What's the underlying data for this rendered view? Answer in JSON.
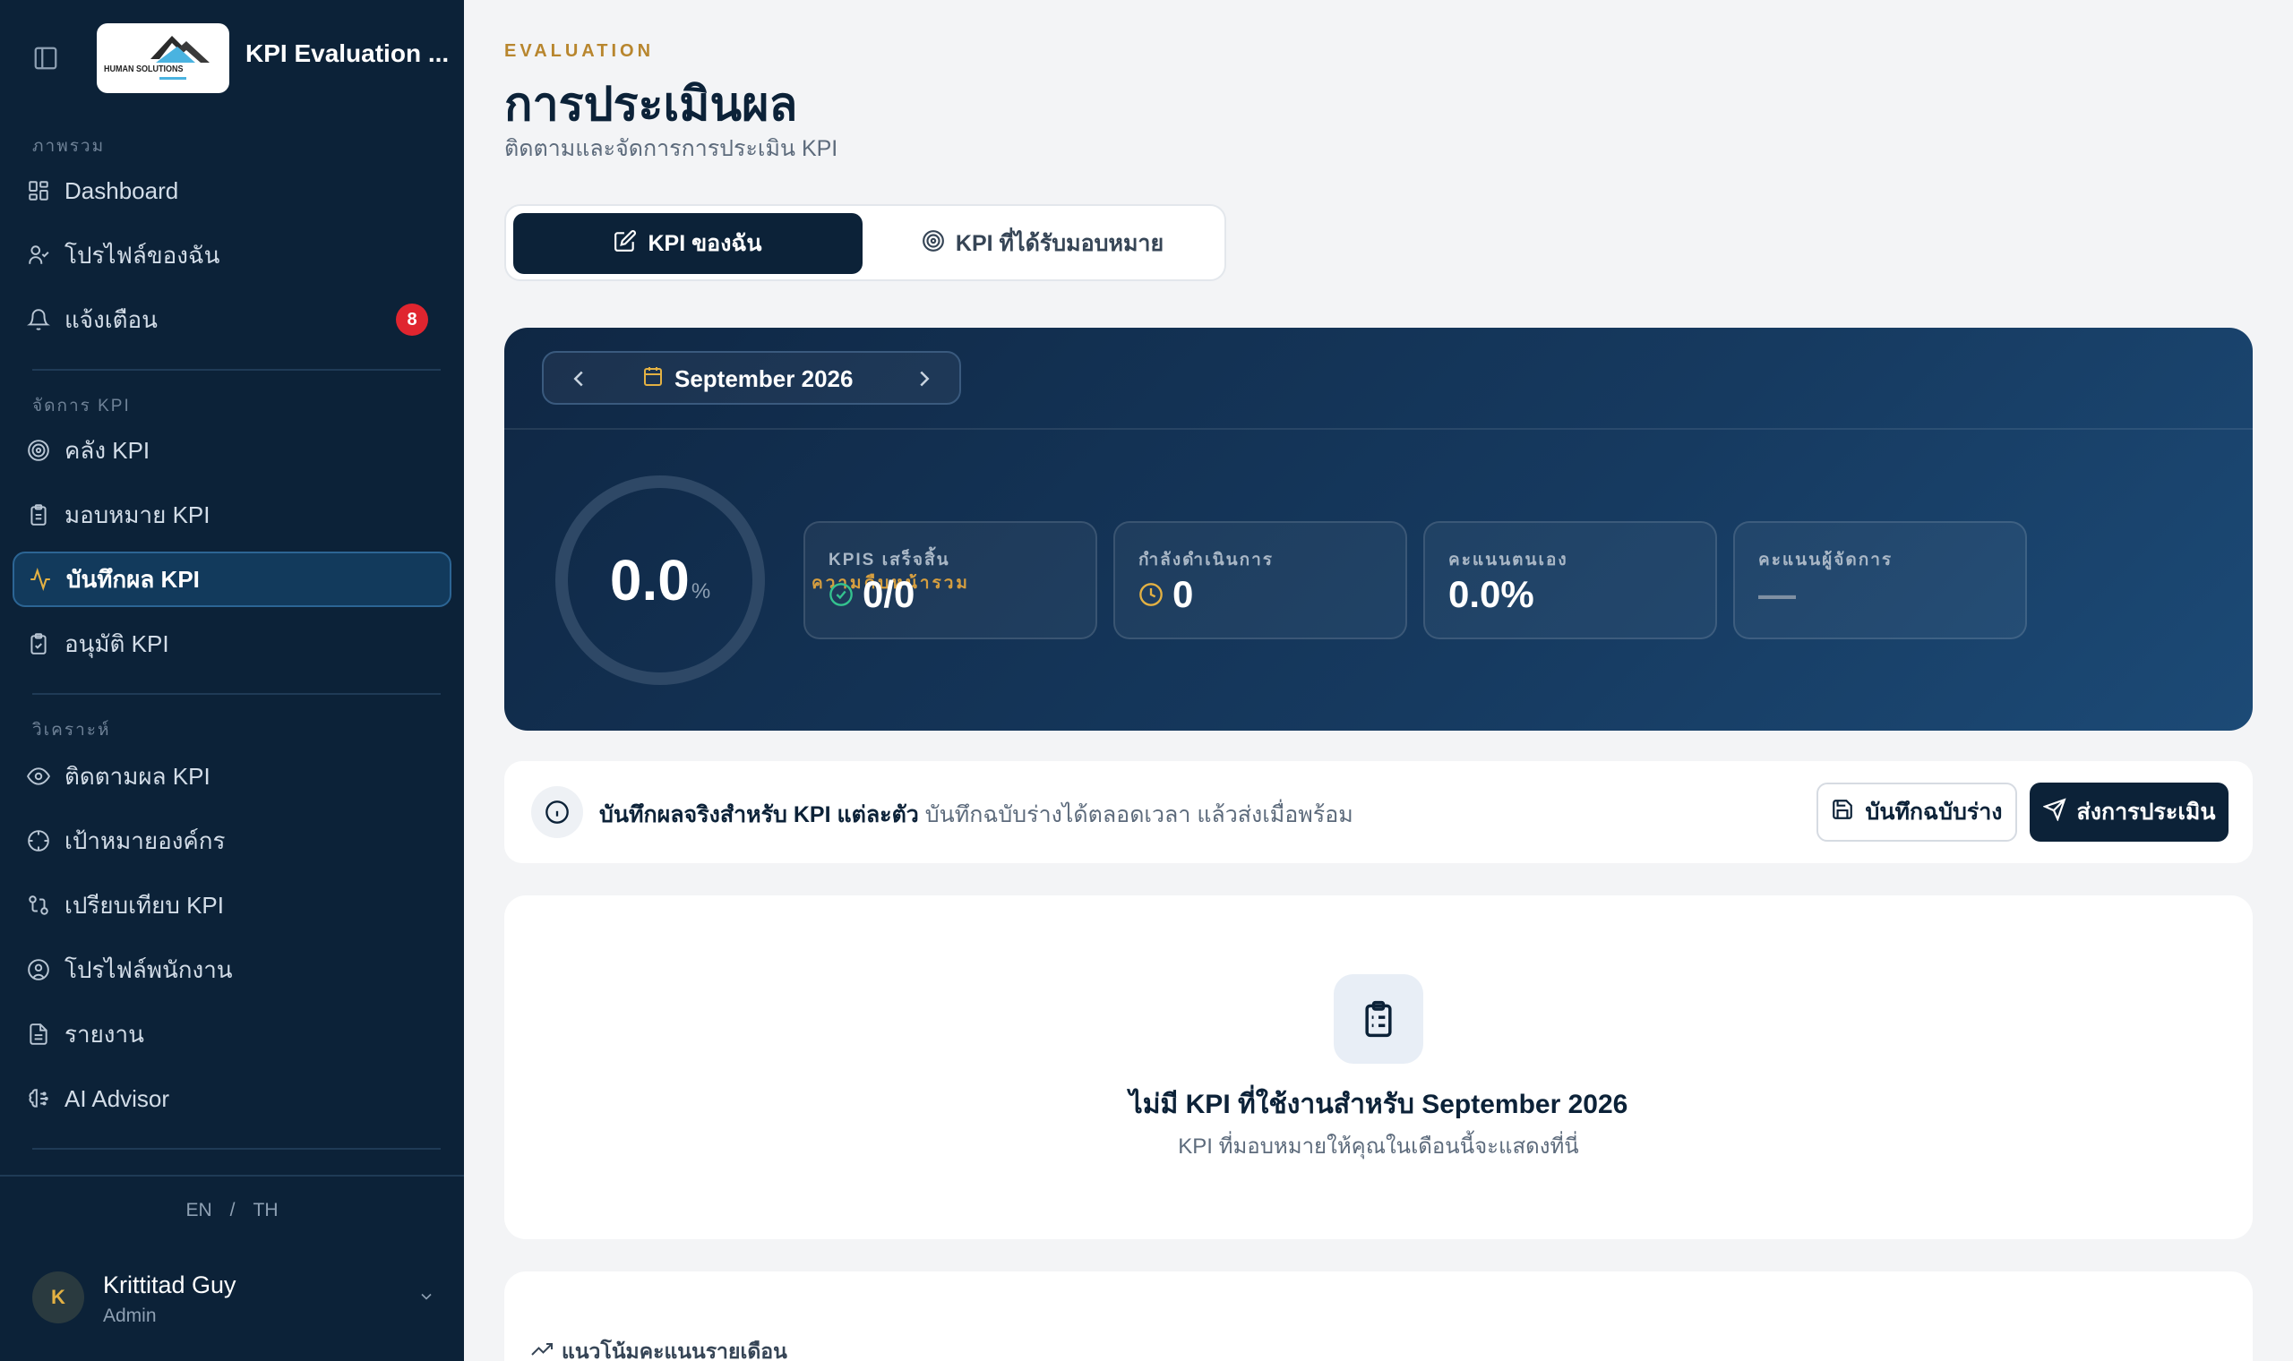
{
  "app": {
    "title": "KPI Evaluation ...",
    "logo_text": "HUMAN SOLUTIONS"
  },
  "sidebar": {
    "sections": [
      {
        "label": "ภาพรวม"
      },
      {
        "label": "จัดการ KPI"
      },
      {
        "label": "วิเคราะห์"
      }
    ],
    "items": [
      {
        "label": "Dashboard",
        "icon": "dashboard-icon"
      },
      {
        "label": "โปรไฟล์ของฉัน",
        "icon": "user-check-icon"
      },
      {
        "label": "แจ้งเตือน",
        "icon": "bell-icon",
        "badge": "8"
      },
      {
        "label": "คลัง KPI",
        "icon": "target-icon"
      },
      {
        "label": "มอบหมาย KPI",
        "icon": "clipboard-icon"
      },
      {
        "label": "บันทึกผล KPI",
        "icon": "activity-icon",
        "active": true
      },
      {
        "label": "อนุมัติ KPI",
        "icon": "clipboard-check-icon"
      },
      {
        "label": "ติดตามผล KPI",
        "icon": "eye-icon"
      },
      {
        "label": "เป้าหมายองค์กร",
        "icon": "crosshair-icon"
      },
      {
        "label": "เปรียบเทียบ KPI",
        "icon": "compare-icon"
      },
      {
        "label": "โปรไฟล์พนักงาน",
        "icon": "user-circle-icon"
      },
      {
        "label": "รายงาน",
        "icon": "file-text-icon"
      },
      {
        "label": "AI Advisor",
        "icon": "brain-icon"
      }
    ],
    "lang": {
      "en": "EN",
      "sep": "/",
      "th": "TH"
    },
    "user": {
      "initial": "K",
      "name": "Krittitad Guy",
      "role": "Admin"
    }
  },
  "page": {
    "eyebrow": "EVALUATION",
    "title": "การประเมินผล",
    "subtitle": "ติดตามและจัดการการประเมิน KPI"
  },
  "tabs": [
    {
      "label": "KPI ของฉัน",
      "active": true
    },
    {
      "label": "KPI ที่ได้รับมอบหมาย",
      "active": false
    }
  ],
  "hero": {
    "month": "September 2026",
    "progress_value": "0.0",
    "progress_unit": "%",
    "progress_fraction": 0,
    "overall_label": "ความคืบหน้ารวม",
    "stats": [
      {
        "label": "KPIS เสร็จสิ้น",
        "value": "0/0",
        "icon": "check-circle-icon"
      },
      {
        "label": "กำลังดำเนินการ",
        "value": "0",
        "icon": "clock-icon"
      },
      {
        "label": "คะแนนตนเอง",
        "value": "0.0%"
      },
      {
        "label": "คะแนนผู้จัดการ",
        "value": "—"
      }
    ]
  },
  "info": {
    "bold": "บันทึกผลจริงสำหรับ KPI แต่ละตัว",
    "text": "บันทึกฉบับร่างได้ตลอดเวลา แล้วส่งเมื่อพร้อม",
    "draft_button": "บันทึกฉบับร่าง",
    "submit_button": "ส่งการประเมิน"
  },
  "empty": {
    "title": "ไม่มี KPI ที่ใช้งานสำหรับ September 2026",
    "subtitle": "KPI ที่มอบหมายให้คุณในเดือนนี้จะแสดงที่นี่"
  },
  "trend": {
    "title": "แนวโน้มคะแนนรายเดือน"
  },
  "colors": {
    "sidebar": "#0c2238",
    "accent_gold": "#d59a35",
    "badge_red": "#e0252f",
    "primary": "#0c2238"
  }
}
